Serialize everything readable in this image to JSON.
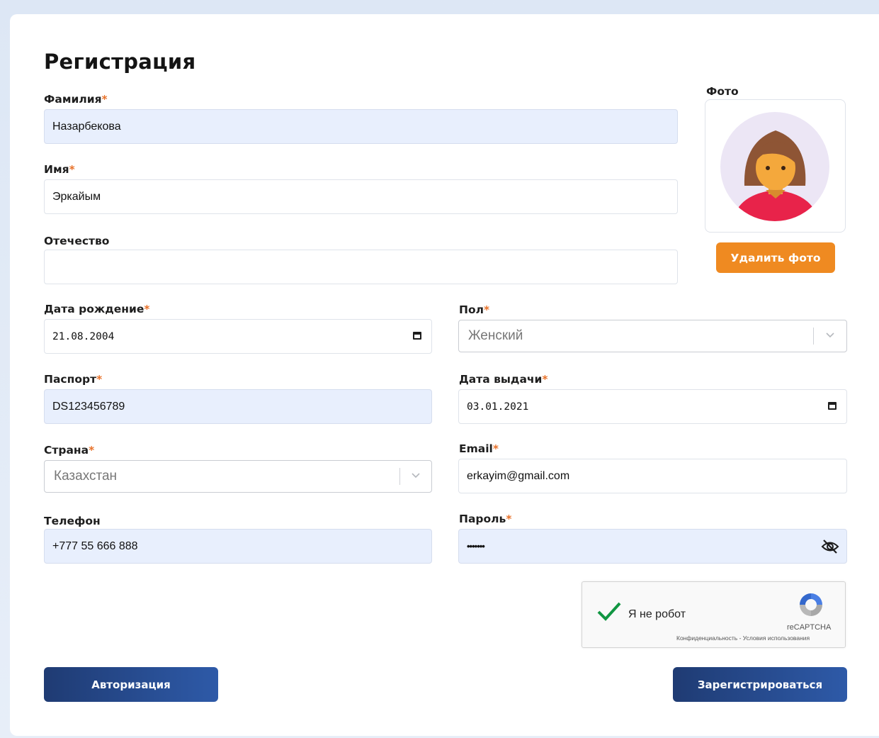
{
  "form": {
    "title": "Регистрация",
    "required_mark": "*"
  },
  "fields": {
    "last_name": {
      "label": "Фамилия",
      "value": "Назарбекова"
    },
    "first_name": {
      "label": "Имя",
      "value": "Эркайым"
    },
    "patronymic": {
      "label": "Отечество",
      "value": ""
    },
    "birth_date": {
      "label": "Дата рождение",
      "value": "21.08.2004"
    },
    "gender": {
      "label": "Пол",
      "value": "Женский"
    },
    "passport": {
      "label": "Паспорт",
      "value": "DS123456789"
    },
    "issue_date": {
      "label": "Дата выдачи",
      "value": "03.01.2021"
    },
    "country": {
      "label": "Страна",
      "value": "Казахстан"
    },
    "email": {
      "label": "Email",
      "value": "erkayim@gmail.com"
    },
    "phone": {
      "label": "Телефон",
      "value": "+777 55 666 888"
    },
    "password": {
      "label": "Пароль",
      "value": "•••••••"
    }
  },
  "photo": {
    "label": "Фото",
    "delete_label": "Удалить фото"
  },
  "captcha": {
    "label": "Я не робот",
    "brand": "reCAPTCHA",
    "links": "Конфиденциальность - Условия использования"
  },
  "buttons": {
    "login": "Авторизация",
    "register": "Зарегистрироваться"
  },
  "colors": {
    "accent_orange": "#ef8a21",
    "primary_blue": "#1f3b73",
    "filled_field": "#e8effd",
    "required": "#e8722a"
  },
  "icons": {
    "calendar": "calendar-icon",
    "chevron": "chevron-down-icon",
    "eye_off": "eye-off-icon",
    "check": "checkmark-icon",
    "recaptcha": "recaptcha-logo-icon",
    "avatar": "female-avatar-icon"
  }
}
